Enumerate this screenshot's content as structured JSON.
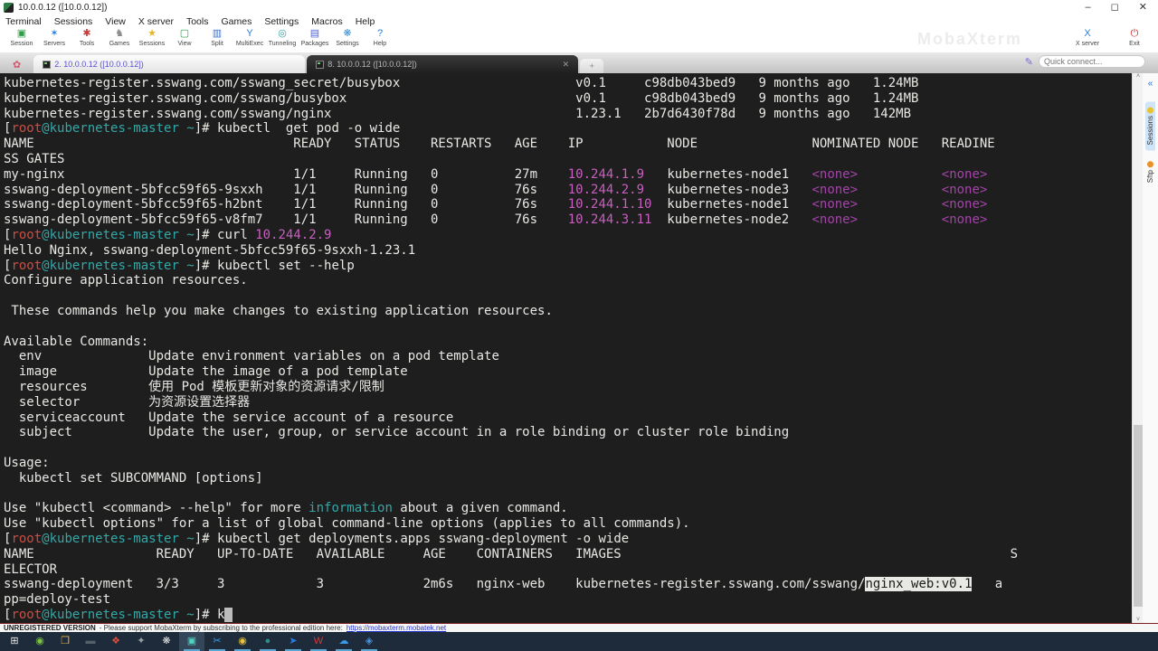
{
  "window": {
    "title": "10.0.0.12 ([10.0.0.12])",
    "controls": {
      "minimize": "–",
      "maximize": "◻",
      "close": "✕"
    }
  },
  "menu": {
    "items": [
      "Terminal",
      "Sessions",
      "View",
      "X server",
      "Tools",
      "Games",
      "Settings",
      "Macros",
      "Help"
    ]
  },
  "toolbar": {
    "buttons": [
      {
        "name": "session-icon",
        "label": "Session",
        "glyph": "▣",
        "color": "#2d9e46"
      },
      {
        "name": "servers-icon",
        "label": "Servers",
        "glyph": "✶",
        "color": "#2a7de1"
      },
      {
        "name": "tools-icon",
        "label": "Tools",
        "glyph": "✱",
        "color": "#c43b3b"
      },
      {
        "name": "games-icon",
        "label": "Games",
        "glyph": "♞",
        "color": "#8a8a8a"
      },
      {
        "name": "sessions-icon",
        "label": "Sessions",
        "glyph": "★",
        "color": "#e8b62c"
      },
      {
        "name": "view-icon",
        "label": "View",
        "glyph": "▢",
        "color": "#2d9e46"
      },
      {
        "name": "split-icon",
        "label": "Split",
        "glyph": "▥",
        "color": "#3a6fd4"
      },
      {
        "name": "multiexec-icon",
        "label": "MultiExec",
        "glyph": "Y",
        "color": "#2a7de1"
      },
      {
        "name": "tunneling-icon",
        "label": "Tunneling",
        "glyph": "◎",
        "color": "#3aa0a0"
      },
      {
        "name": "packages-icon",
        "label": "Packages",
        "glyph": "▤",
        "color": "#4a5fd4"
      },
      {
        "name": "settings-icon",
        "label": "Settings",
        "glyph": "❋",
        "color": "#3a8fd4"
      },
      {
        "name": "help-icon",
        "label": "Help",
        "glyph": "?",
        "color": "#2a7de1"
      }
    ],
    "right": [
      {
        "name": "x-server-icon",
        "label": "X server",
        "glyph": "X",
        "color": "#2a7de1"
      },
      {
        "name": "exit-icon",
        "label": "Exit",
        "glyph": "⏻",
        "color": "#d42a2a"
      }
    ],
    "watermark": "MobaXterm"
  },
  "tabbar": {
    "tabs": [
      {
        "label": "2. 10.0.0.12 ([10.0.0.12])",
        "active": false
      },
      {
        "label": "8. 10.0.0.12 ([10.0.0.12])",
        "active": true
      }
    ],
    "new_tab": "+",
    "close_glyph": "✕",
    "quick_connect_placeholder": "Quick connect..."
  },
  "sidebar": {
    "collapse_glyph": "«",
    "tabs": [
      {
        "label": "Sessions",
        "dot_color": "#e8c32c",
        "active": true
      },
      {
        "label": "Sftp",
        "dot_color": "#e8922c",
        "active": false
      }
    ]
  },
  "terminal": {
    "lines": [
      [
        {
          "t": "kubernetes-register.sswang.com/sswang_secret/busybox                       v0.1     c98db043bed9   9 months ago   1.24MB",
          "c": "fg"
        }
      ],
      [
        {
          "t": "kubernetes-register.sswang.com/sswang/busybox                              v0.1     c98db043bed9   9 months ago   1.24MB",
          "c": "fg"
        }
      ],
      [
        {
          "t": "kubernetes-register.sswang.com/sswang/nginx                                1.23.1   2b7d6430f78d   9 months ago   142MB",
          "c": "fg"
        }
      ],
      [
        {
          "t": "[",
          "c": "fg"
        },
        {
          "t": "root",
          "c": "red"
        },
        {
          "t": "@kubernetes-master ~",
          "c": "teal"
        },
        {
          "t": "]# ",
          "c": "fg"
        },
        {
          "t": "kubectl  get pod -o wide",
          "c": "fg"
        }
      ],
      [
        {
          "t": "NAME                                  READY   STATUS    RESTARTS   AGE    IP           NODE               NOMINATED NODE   READINE",
          "c": "fg"
        }
      ],
      [
        {
          "t": "SS GATES",
          "c": "fg"
        }
      ],
      [
        {
          "t": "my-nginx                              1/1     Running   0          27m    ",
          "c": "fg"
        },
        {
          "t": "10.244.1.9",
          "c": "magenta"
        },
        {
          "t": "   kubernetes-node1   ",
          "c": "fg"
        },
        {
          "t": "<none>",
          "c": "purple"
        },
        {
          "t": "           ",
          "c": "fg"
        },
        {
          "t": "<none>",
          "c": "purple"
        }
      ],
      [
        {
          "t": "sswang-deployment-5bfcc59f65-9sxxh    1/1     Running   0          76s    ",
          "c": "fg"
        },
        {
          "t": "10.244.2.9",
          "c": "magenta"
        },
        {
          "t": "   kubernetes-node3   ",
          "c": "fg"
        },
        {
          "t": "<none>",
          "c": "purple"
        },
        {
          "t": "           ",
          "c": "fg"
        },
        {
          "t": "<none>",
          "c": "purple"
        }
      ],
      [
        {
          "t": "sswang-deployment-5bfcc59f65-h2bnt    1/1     Running   0          76s    ",
          "c": "fg"
        },
        {
          "t": "10.244.1.10",
          "c": "magenta"
        },
        {
          "t": "  kubernetes-node1   ",
          "c": "fg"
        },
        {
          "t": "<none>",
          "c": "purple"
        },
        {
          "t": "           ",
          "c": "fg"
        },
        {
          "t": "<none>",
          "c": "purple"
        }
      ],
      [
        {
          "t": "sswang-deployment-5bfcc59f65-v8fm7    1/1     Running   0          76s    ",
          "c": "fg"
        },
        {
          "t": "10.244.3.11",
          "c": "magenta"
        },
        {
          "t": "  kubernetes-node2   ",
          "c": "fg"
        },
        {
          "t": "<none>",
          "c": "purple"
        },
        {
          "t": "           ",
          "c": "fg"
        },
        {
          "t": "<none>",
          "c": "purple"
        }
      ],
      [
        {
          "t": "[",
          "c": "fg"
        },
        {
          "t": "root",
          "c": "red"
        },
        {
          "t": "@kubernetes-master ~",
          "c": "teal"
        },
        {
          "t": "]# ",
          "c": "fg"
        },
        {
          "t": "curl ",
          "c": "fg"
        },
        {
          "t": "10.244.2.9",
          "c": "magenta"
        }
      ],
      [
        {
          "t": "Hello Nginx, sswang-deployment-5bfcc59f65-9sxxh-1.23.1",
          "c": "fg"
        }
      ],
      [
        {
          "t": "[",
          "c": "fg"
        },
        {
          "t": "root",
          "c": "red"
        },
        {
          "t": "@kubernetes-master ~",
          "c": "teal"
        },
        {
          "t": "]# ",
          "c": "fg"
        },
        {
          "t": "kubectl set --help",
          "c": "fg"
        }
      ],
      [
        {
          "t": "Configure application resources.",
          "c": "fg"
        }
      ],
      [
        {
          "t": "",
          "c": "fg"
        }
      ],
      [
        {
          "t": " These commands help you make changes to existing application resources.",
          "c": "fg"
        }
      ],
      [
        {
          "t": "",
          "c": "fg"
        }
      ],
      [
        {
          "t": "Available Commands:",
          "c": "fg"
        }
      ],
      [
        {
          "t": "  env              Update environment variables on a pod template",
          "c": "fg"
        }
      ],
      [
        {
          "t": "  image            Update the image of a pod template",
          "c": "fg"
        }
      ],
      [
        {
          "t": "  resources        使用 Pod 模板更新对象的资源请求/限制",
          "c": "fg"
        }
      ],
      [
        {
          "t": "  selector         为资源设置选择器",
          "c": "fg"
        }
      ],
      [
        {
          "t": "  serviceaccount   Update the service account of a resource",
          "c": "fg"
        }
      ],
      [
        {
          "t": "  subject          Update the user, group, or service account in a role binding or cluster role binding",
          "c": "fg"
        }
      ],
      [
        {
          "t": "",
          "c": "fg"
        }
      ],
      [
        {
          "t": "Usage:",
          "c": "fg"
        }
      ],
      [
        {
          "t": "  kubectl set SUBCOMMAND [options]",
          "c": "fg"
        }
      ],
      [
        {
          "t": "",
          "c": "fg"
        }
      ],
      [
        {
          "t": "Use \"kubectl <command> --help\" for more ",
          "c": "fg"
        },
        {
          "t": "information",
          "c": "teal"
        },
        {
          "t": " about a given command.",
          "c": "fg"
        }
      ],
      [
        {
          "t": "Use \"kubectl options\" for a list of global command-line options (applies to all commands).",
          "c": "fg"
        }
      ],
      [
        {
          "t": "[",
          "c": "fg"
        },
        {
          "t": "root",
          "c": "red"
        },
        {
          "t": "@kubernetes-master ~",
          "c": "teal"
        },
        {
          "t": "]# ",
          "c": "fg"
        },
        {
          "t": "kubectl get deployments.apps sswang-deployment -o wide",
          "c": "fg"
        }
      ],
      [
        {
          "t": "NAME                READY   UP-TO-DATE   AVAILABLE     AGE    CONTAINERS   IMAGES                                                   S",
          "c": "fg"
        }
      ],
      [
        {
          "t": "ELECTOR",
          "c": "fg"
        }
      ],
      [
        {
          "t": "sswang-deployment   3/3     3            3             2m6s   nginx-web    kubernetes-register.sswang.com/sswang/",
          "c": "fg"
        },
        {
          "t": "nginx_web:v0.1",
          "c": "hl"
        },
        {
          "t": "   a",
          "c": "fg"
        }
      ],
      [
        {
          "t": "pp=deploy-test",
          "c": "fg"
        }
      ],
      [
        {
          "t": "[",
          "c": "fg"
        },
        {
          "t": "root",
          "c": "red"
        },
        {
          "t": "@kubernetes-master ~",
          "c": "teal"
        },
        {
          "t": "]# ",
          "c": "fg"
        },
        {
          "t": "k",
          "c": "fg"
        },
        {
          "t": " ",
          "c": "cursor"
        }
      ]
    ]
  },
  "scrollbar": {
    "up_glyph": "˄",
    "down_glyph": "˅"
  },
  "statusbar": {
    "version": "UNREGISTERED VERSION",
    "message": "-  Please support MobaXterm by subscribing to the professional edition here:",
    "link": "https://mobaxterm.mobatek.net"
  },
  "taskbar": {
    "icons": [
      {
        "name": "start-button",
        "glyph": "⊞",
        "color": "#e8e8e8",
        "running": false,
        "active": false
      },
      {
        "name": "green-app-icon",
        "glyph": "◉",
        "color": "#7dc540",
        "running": false,
        "active": false
      },
      {
        "name": "file-explorer-icon",
        "glyph": "❒",
        "color": "#e8b64c",
        "running": false,
        "active": false
      },
      {
        "name": "dark-app-icon",
        "glyph": "▬",
        "color": "#55606b",
        "running": false,
        "active": false
      },
      {
        "name": "colorful-app-icon",
        "glyph": "❖",
        "color": "#d94f3d",
        "running": false,
        "active": false
      },
      {
        "name": "gray-app-icon",
        "glyph": "✦",
        "color": "#9aa0a6",
        "running": false,
        "active": false
      },
      {
        "name": "white-flower-icon",
        "glyph": "❋",
        "color": "#e8e8e8",
        "running": false,
        "active": false
      },
      {
        "name": "mobaxterm-icon",
        "glyph": "▣",
        "color": "#4fd4c0",
        "running": true,
        "active": true
      },
      {
        "name": "screenshot-app-icon",
        "glyph": "✂",
        "color": "#3aa0e8",
        "running": true,
        "active": false
      },
      {
        "name": "chrome-icon",
        "glyph": "◉",
        "color": "#e8c33c",
        "running": true,
        "active": false
      },
      {
        "name": "teal-app-icon",
        "glyph": "●",
        "color": "#2e8b8b",
        "running": true,
        "active": false
      },
      {
        "name": "blue-bird-app-icon",
        "glyph": "➤",
        "color": "#2a7de1",
        "running": true,
        "active": false
      },
      {
        "name": "wps-icon",
        "glyph": "W",
        "color": "#d43a3a",
        "running": true,
        "active": false
      },
      {
        "name": "cloud-app-icon",
        "glyph": "☁",
        "color": "#3a9ae8",
        "running": true,
        "active": false
      },
      {
        "name": "blue-circle-app-icon",
        "glyph": "◈",
        "color": "#4a90d9",
        "running": true,
        "active": false
      }
    ]
  }
}
